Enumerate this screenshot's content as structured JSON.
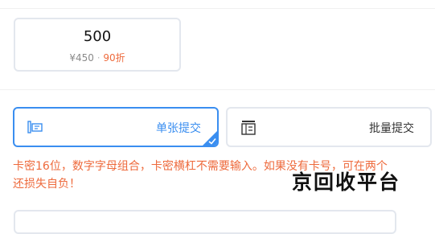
{
  "denomination_card": {
    "value": "500",
    "price": "¥450",
    "separator": "·",
    "discount": "90折"
  },
  "modes": {
    "single": {
      "label": "单张提交",
      "icon": "card-scan-icon",
      "selected": true
    },
    "batch": {
      "label": "批量提交",
      "icon": "batch-cards-icon",
      "selected": false
    }
  },
  "notice": {
    "line1": "卡密16位，数字字母组合，卡密横杠不需要输入。如果没有卡号，可在两个",
    "line2": "还损失自负！"
  },
  "watermark": "京回收平台",
  "colors": {
    "accent": "#3a8ef0",
    "warning": "#ee6a3c",
    "border": "#e3e7ee"
  }
}
